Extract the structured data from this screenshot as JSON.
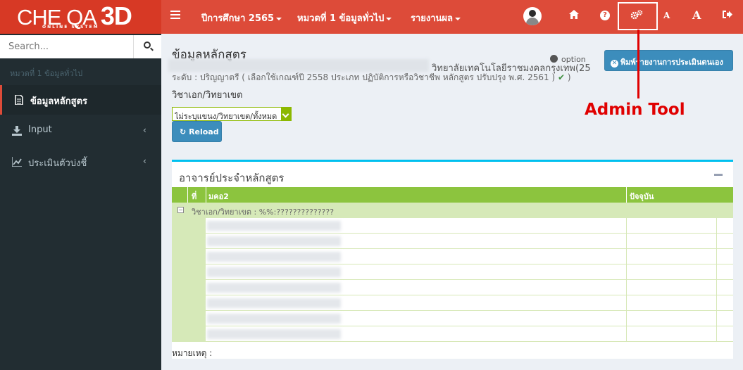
{
  "app": {
    "logo_main": "CHE QA",
    "logo_3d": "3D",
    "logo_sub": "ONLINE   SYSTEM"
  },
  "topnav": {
    "year": "ปีการศึกษา 2565",
    "category": "หมวดที่ 1 ข้อมูลทั่วไป",
    "report": "รายงานผล",
    "font_small": "A",
    "font_large": "A"
  },
  "sidebar": {
    "search_placeholder": "Search...",
    "header": "หมวดที่ 1 ข้อมูลทั่วไป",
    "items": [
      {
        "label": "ข้อมูลหลักสูตร",
        "icon": "document-icon",
        "active": true
      },
      {
        "label": "Input",
        "icon": "download-icon",
        "active": false
      },
      {
        "label": "ประเมินตัวบ่งชี้",
        "icon": "line-chart-icon",
        "active": false
      }
    ]
  },
  "content": {
    "title": "ข้อมูลหลักสูตร",
    "institution": "วิทยาลัยเทคโนโลยีราชมงคลกรุงเทพ(25",
    "level_text": "ระดับ : ปริญญาตรี ( เลือกใช้เกณฑ์ปี 2558 ประเภท ปฏิบัติการหรือวิชาชีพ หลักสูตร ปรับปรุง พ.ศ. 2561 )",
    "major_label": "วิชาเอก/วิทยาเขต",
    "option": "option",
    "print_button": "พิมพ์รายงานการประเมินตนเอง",
    "select_value": "ไม่ระบุแขนง/วิทยาเขต/ทั้งหมด",
    "reload": "Reload",
    "annotation": "Admin Tool"
  },
  "table": {
    "title": "อาจารย์ประจำหลักสูตร",
    "headers": [
      "ที่",
      "มคอ2",
      "ปัจจุบัน"
    ],
    "group": "วิชาเอก/วิทยาเขต : %%:??????????????",
    "note": "หมายเหตุ :"
  },
  "colors": {
    "header": "#dd4b39",
    "sidebar": "#222d32",
    "primary_button": "#3c8dbc",
    "table_header": "#8cc43e",
    "annotation": "#e00000"
  }
}
